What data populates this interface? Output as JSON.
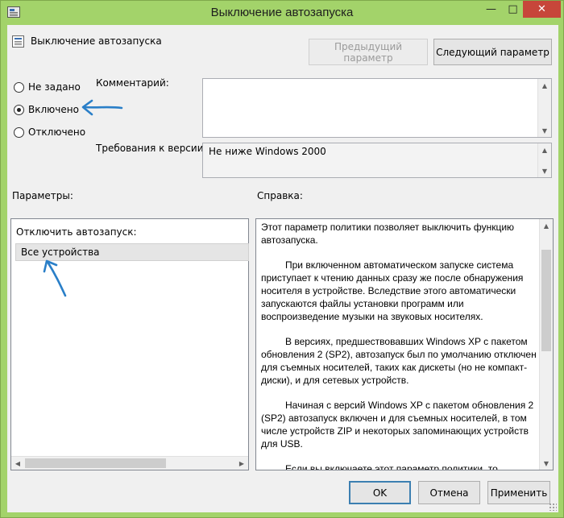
{
  "window": {
    "title": "Выключение автозапуска"
  },
  "policy": {
    "name": "Выключение автозапуска"
  },
  "nav": {
    "prev_label": "Предыдущий параметр",
    "next_label": "Следующий параметр"
  },
  "state": {
    "options": [
      {
        "label": "Не задано",
        "selected": false
      },
      {
        "label": "Включено",
        "selected": true
      },
      {
        "label": "Отключено",
        "selected": false
      }
    ]
  },
  "comment": {
    "label": "Комментарий:",
    "value": ""
  },
  "requirements": {
    "label": "Требования к версии:",
    "value": "Не ниже Windows 2000"
  },
  "params": {
    "label": "Параметры:",
    "option_title": "Отключить автозапуск:",
    "selected_value": "Все устройства"
  },
  "help": {
    "label": "Справка:",
    "paragraphs": [
      "Этот параметр политики позволяет выключить функцию автозапуска.",
      "При включенном автоматическом запуске система приступает к чтению данных сразу же после обнаружения носителя в устройстве. Вследствие этого автоматически запускаются файлы установки программ или воспроизведение музыки на звуковых носителях.",
      "В версиях, предшествовавших Windows XP с пакетом обновления 2 (SP2), автозапуск был по умолчанию отключен для съемных носителей, таких как дискеты (но не компакт-диски), и для сетевых устройств.",
      "Начиная с версий Windows XP с пакетом обновления 2 (SP2) автозапуск включен и для съемных носителей, в том числе устройств ZIP и некоторых запоминающих устройств для USB.",
      "Если вы включаете этот параметр политики, то"
    ]
  },
  "footer": {
    "ok_label": "OK",
    "cancel_label": "Отмена",
    "apply_label": "Применить"
  },
  "colors": {
    "frame": "#a3d36a",
    "close": "#c7463a",
    "annotation": "#2a7fc8"
  }
}
